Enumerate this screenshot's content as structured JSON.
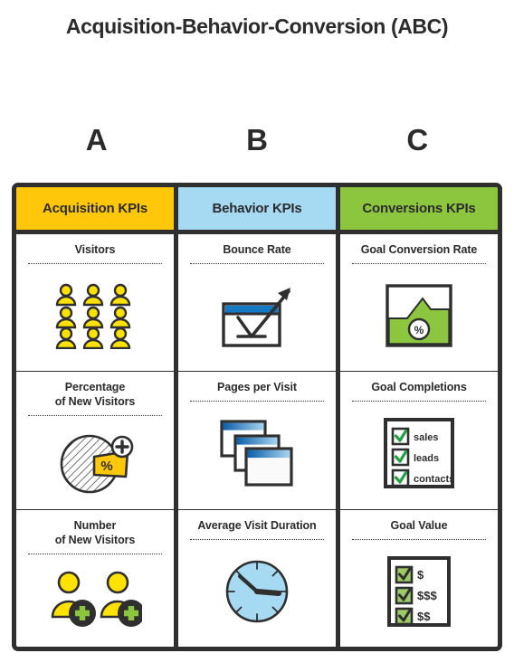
{
  "title": "Acquisition-Behavior-Conversion (ABC)",
  "letters": [
    {
      "id": "letter-a",
      "text": "A"
    },
    {
      "id": "letter-b",
      "text": "B"
    },
    {
      "id": "letter-c",
      "text": "C"
    }
  ],
  "colors": {
    "acquisition": "#FFC709",
    "behavior": "#A6D9F2",
    "conversions": "#8CC63E",
    "frame": "#2F2F2F",
    "window_blue": "#1379C4",
    "check_green": "#22A043",
    "text": "#2B2B2B"
  },
  "columns": [
    {
      "key": "acquisition",
      "header": "Acquisition KPIs",
      "header_bg": "#FFC709",
      "kpis": [
        {
          "label": "Visitors",
          "icon": "people-grid-icon"
        },
        {
          "label": "Percentage\nof New Visitors",
          "icon": "pie-chart-percent-icon"
        },
        {
          "label": "Number\nof New Visitors",
          "icon": "new-visitors-icon"
        }
      ]
    },
    {
      "key": "behavior",
      "header": "Behavior KPIs",
      "header_bg": "#A6D9F2",
      "kpis": [
        {
          "label": "Bounce Rate",
          "icon": "bounce-arrow-window-icon"
        },
        {
          "label": "Pages per Visit",
          "icon": "stacked-windows-icon"
        },
        {
          "label": "Average Visit Duration",
          "icon": "clock-icon"
        }
      ]
    },
    {
      "key": "conversions",
      "header": "Conversions KPIs",
      "header_bg": "#8CC63E",
      "kpis": [
        {
          "label": "Goal Conversion Rate",
          "icon": "area-chart-percent-icon"
        },
        {
          "label": "Goal Completions",
          "icon": "goal-checklist-icon"
        },
        {
          "label": "Goal Value",
          "icon": "goal-value-checklist-icon"
        }
      ]
    }
  ],
  "icon_text": {
    "percent_symbol": "%",
    "goal_completions_items": [
      "sales",
      "leads",
      "contacts"
    ],
    "goal_value_items": [
      "$",
      "$$$",
      "$$"
    ]
  }
}
